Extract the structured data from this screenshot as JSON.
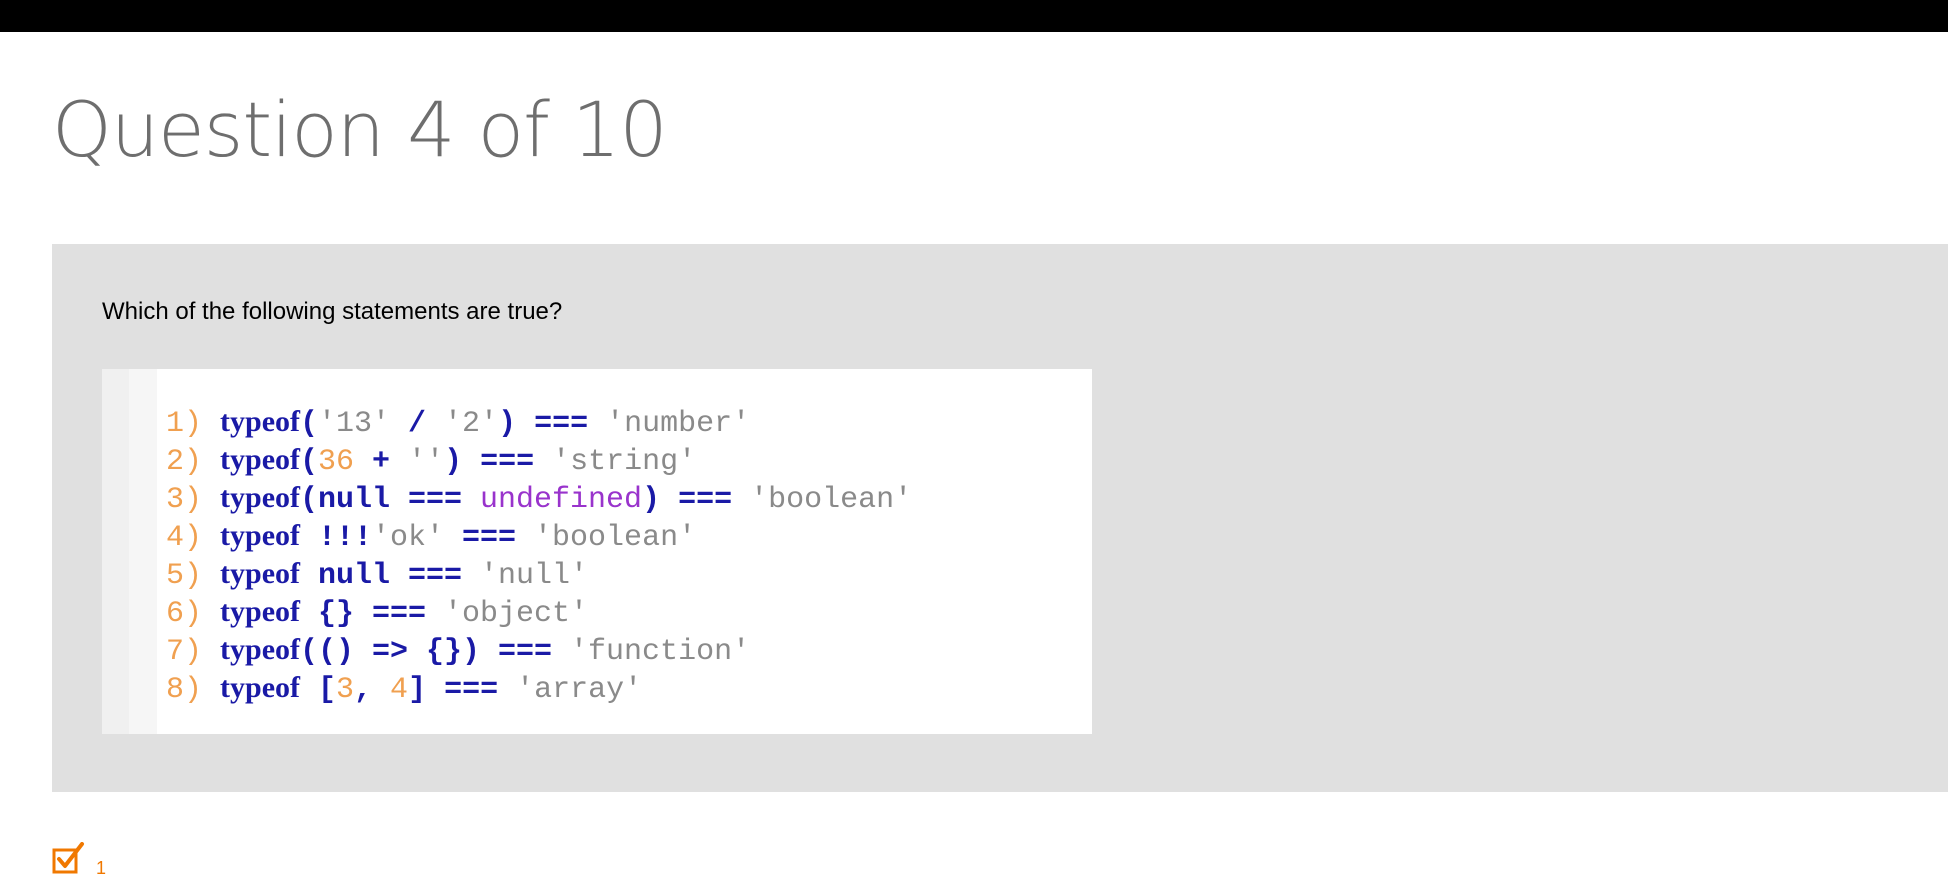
{
  "header": {
    "title": "Question 4 of 10"
  },
  "question": {
    "prompt": "Which of the following statements are true?",
    "code": [
      [
        [
          "ln",
          "1) "
        ],
        [
          "kw",
          "typeof"
        ],
        [
          "op",
          "("
        ],
        [
          "str",
          "'13'"
        ],
        [
          "op",
          " / "
        ],
        [
          "str",
          "'2'"
        ],
        [
          "op",
          ") === "
        ],
        [
          "str",
          "'number'"
        ]
      ],
      [
        [
          "ln",
          "2) "
        ],
        [
          "kw",
          "typeof"
        ],
        [
          "op",
          "("
        ],
        [
          "num",
          "36"
        ],
        [
          "op",
          " + "
        ],
        [
          "str",
          "''"
        ],
        [
          "op",
          ") === "
        ],
        [
          "str",
          "'string'"
        ]
      ],
      [
        [
          "ln",
          "3) "
        ],
        [
          "kw",
          "typeof"
        ],
        [
          "op",
          "(null === "
        ],
        [
          "kw2",
          "undefined"
        ],
        [
          "op",
          ") === "
        ],
        [
          "str",
          "'boolean'"
        ]
      ],
      [
        [
          "ln",
          "4) "
        ],
        [
          "kw",
          "typeof"
        ],
        [
          "op",
          " !!!"
        ],
        [
          "str",
          "'ok'"
        ],
        [
          "op",
          " === "
        ],
        [
          "str",
          "'boolean'"
        ]
      ],
      [
        [
          "ln",
          "5) "
        ],
        [
          "kw",
          "typeof"
        ],
        [
          "op",
          " null === "
        ],
        [
          "str",
          "'null'"
        ]
      ],
      [
        [
          "ln",
          "6) "
        ],
        [
          "kw",
          "typeof"
        ],
        [
          "op",
          " {} === "
        ],
        [
          "str",
          "'object'"
        ]
      ],
      [
        [
          "ln",
          "7) "
        ],
        [
          "kw",
          "typeof"
        ],
        [
          "op",
          "(() => {}) === "
        ],
        [
          "str",
          "'function'"
        ]
      ],
      [
        [
          "ln",
          "8) "
        ],
        [
          "kw",
          "typeof"
        ],
        [
          "op",
          " ["
        ],
        [
          "num",
          "3"
        ],
        [
          "op",
          ", "
        ],
        [
          "num",
          "4"
        ],
        [
          "op",
          "] === "
        ],
        [
          "str",
          "'array'"
        ]
      ]
    ]
  },
  "answers": [
    {
      "label": "1",
      "checked": true,
      "icon": "checked-checkbox-icon",
      "color": "#f07800"
    }
  ]
}
